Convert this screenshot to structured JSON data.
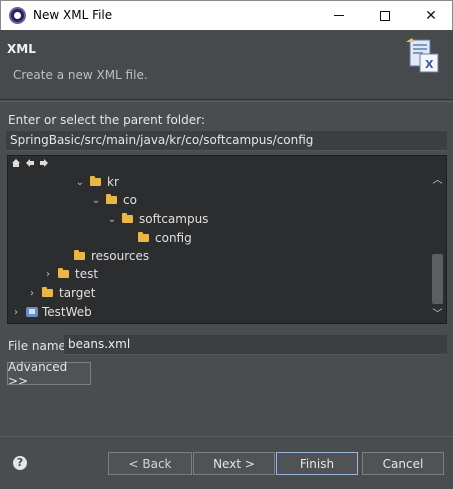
{
  "window": {
    "title": "New XML File",
    "minimize": "",
    "maximize": "",
    "close": "✕"
  },
  "banner": {
    "heading": "XML",
    "description": "Create a new XML file."
  },
  "parent_folder": {
    "label": "Enter or select the parent folder:",
    "value": "SpringBasic/src/main/java/kr/co/softcampus/config"
  },
  "tree": {
    "toolbar": [
      "home-icon",
      "back-icon",
      "forward-icon"
    ],
    "items": [
      {
        "label": "kr",
        "chevron": "⌄",
        "icon": "folder"
      },
      {
        "label": "co",
        "chevron": "⌄",
        "icon": "folder"
      },
      {
        "label": "softcampus",
        "chevron": "⌄",
        "icon": "folder"
      },
      {
        "label": "config",
        "chevron": "",
        "icon": "folder"
      },
      {
        "label": "resources",
        "chevron": "",
        "icon": "folder"
      },
      {
        "label": "test",
        "chevron": "›",
        "icon": "folder"
      },
      {
        "label": "target",
        "chevron": "›",
        "icon": "folder"
      },
      {
        "label": "TestWeb",
        "chevron": "›",
        "icon": "project"
      }
    ]
  },
  "file_name": {
    "label": "File name:",
    "value": "beans.xml"
  },
  "buttons": {
    "advanced": "Advanced >>",
    "back": "< Back",
    "next": "Next >",
    "finish": "Finish",
    "cancel": "Cancel"
  },
  "colors": {
    "background": "#4a4d50",
    "tree_background": "#2b2d2f",
    "folder": "#e7b74c",
    "default_button_border": "#9ab6d8"
  }
}
